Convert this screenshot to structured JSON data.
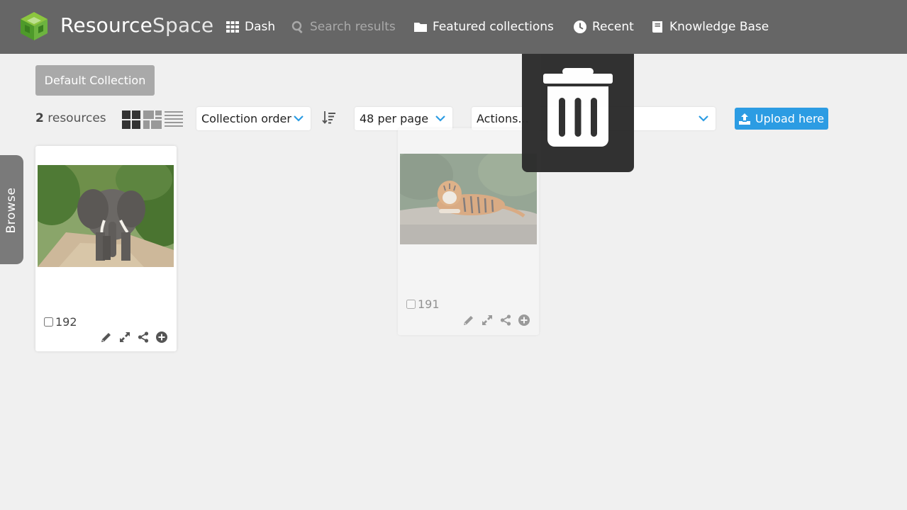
{
  "header": {
    "brand_primary": "Resource",
    "brand_secondary": "Space",
    "nav": [
      {
        "label": "Dash",
        "icon": "grid-icon",
        "enabled": true
      },
      {
        "label": "Search results",
        "icon": "search-icon",
        "enabled": false
      },
      {
        "label": "Featured collections",
        "icon": "folder-icon",
        "enabled": true
      },
      {
        "label": "Recent",
        "icon": "clock-icon",
        "enabled": true
      },
      {
        "label": "Knowledge Base",
        "icon": "book-icon",
        "enabled": true
      }
    ]
  },
  "collection": {
    "label": "Default Collection"
  },
  "toolbar": {
    "count": "2",
    "count_suffix": " resources",
    "views": [
      "large-thumbs-icon",
      "small-thumbs-icon",
      "list-view-icon"
    ],
    "order_select": "Collection order",
    "per_page_select": "48 per page",
    "actions_select": "Actions...",
    "upload_label": "Upload here"
  },
  "sidebar": {
    "browse_label": "Browse"
  },
  "resources": [
    {
      "ref": "192",
      "image": "elephant-photo",
      "dragging": false
    },
    {
      "ref": "191",
      "image": "tiger-photo",
      "dragging": true
    }
  ],
  "trash": {
    "icon": "trash-icon"
  },
  "colors": {
    "header_bg": "#666666",
    "accent_blue": "#2c9ce3",
    "logo_green": "#6db33f",
    "background": "#f0f0f0"
  }
}
